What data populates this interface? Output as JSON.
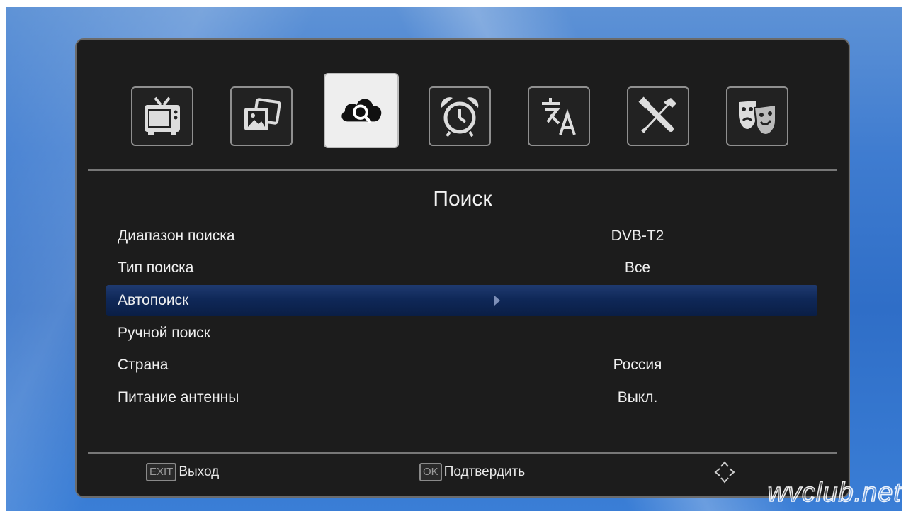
{
  "menu": {
    "tabs": [
      {
        "name": "tv-icon",
        "active": false
      },
      {
        "name": "pictures-icon",
        "active": false
      },
      {
        "name": "search-cloud-icon",
        "active": true
      },
      {
        "name": "alarm-clock-icon",
        "active": false
      },
      {
        "name": "language-icon",
        "active": false
      },
      {
        "name": "tools-icon",
        "active": false
      },
      {
        "name": "theater-masks-icon",
        "active": false
      }
    ]
  },
  "screen": {
    "title": "Поиск",
    "rows": [
      {
        "label": "Диапазон поиска",
        "value": "DVB-T2",
        "selected": false
      },
      {
        "label": "Тип поиска",
        "value": "Все",
        "selected": false
      },
      {
        "label": "Автопоиск",
        "value": "",
        "selected": true
      },
      {
        "label": "Ручной поиск",
        "value": "",
        "selected": false
      },
      {
        "label": "Страна",
        "value": "Россия",
        "selected": false
      },
      {
        "label": "Питание антенны",
        "value": "Выкл.",
        "selected": false
      }
    ]
  },
  "footer": {
    "exit_key": "EXIT",
    "exit_label": "Выход",
    "ok_key": "OK",
    "ok_label": "Подтвердить",
    "nav_icon": "navigation-arrows-icon"
  },
  "watermark": "wvclub.net",
  "colors": {
    "panel_bg": "#1c1c1c",
    "selected_row": "#0f2858",
    "active_tab": "#eeeeee"
  }
}
